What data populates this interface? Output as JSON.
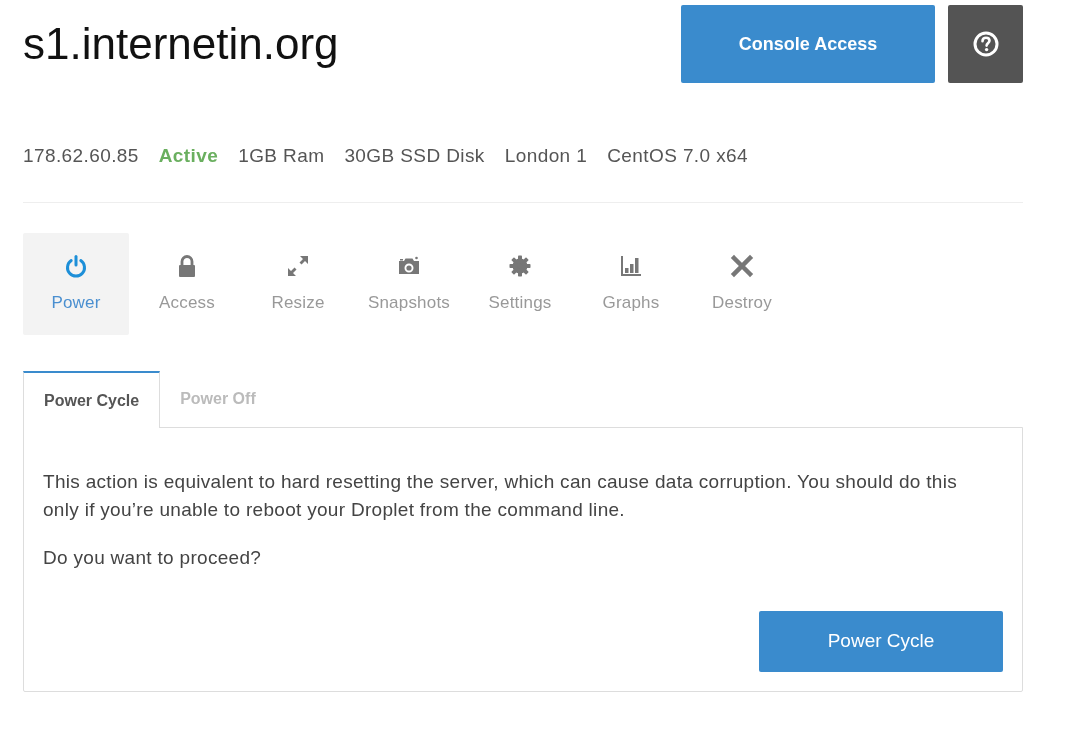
{
  "header": {
    "title": "s1.internetin.org",
    "console_button": "Console Access"
  },
  "droplet_info": [
    {
      "text": "178.62.60.85",
      "kind": "plain"
    },
    {
      "text": "Active",
      "kind": "status"
    },
    {
      "text": "1GB Ram",
      "kind": "plain"
    },
    {
      "text": "30GB SSD Disk",
      "kind": "plain"
    },
    {
      "text": "London 1",
      "kind": "plain"
    },
    {
      "text": "CentOS 7.0 x64",
      "kind": "plain"
    }
  ],
  "nav": [
    {
      "label": "Power",
      "selected": true
    },
    {
      "label": "Access",
      "selected": false
    },
    {
      "label": "Resize",
      "selected": false
    },
    {
      "label": "Snapshots",
      "selected": false
    },
    {
      "label": "Settings",
      "selected": false
    },
    {
      "label": "Graphs",
      "selected": false
    },
    {
      "label": "Destroy",
      "selected": false
    }
  ],
  "action_tabs": [
    {
      "label": "Power Cycle",
      "selected": true
    },
    {
      "label": "Power Off",
      "selected": false
    }
  ],
  "panel": {
    "paragraphs": [
      "This action is equivalent to hard resetting the server, which can cause data corruption. You should do this only if you’re unable to reboot your Droplet from the command line.",
      "Do you want to proceed?"
    ],
    "button": "Power Cycle"
  }
}
